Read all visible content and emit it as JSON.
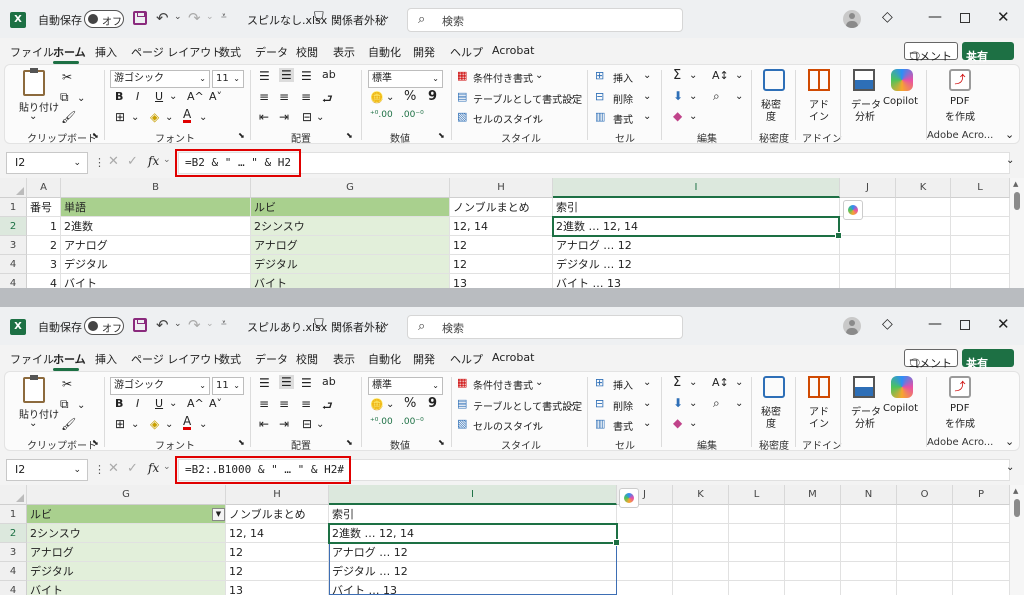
{
  "title": {
    "autosave": "自動保存",
    "toggle": "オフ",
    "sensitivity": "関係者外秘",
    "search_placeholder": "検索"
  },
  "menu": {
    "tabs": [
      "ファイル",
      "ホーム",
      "挿入",
      "ページ レイアウト",
      "数式",
      "データ",
      "校閲",
      "表示",
      "自動化",
      "開発",
      "ヘルプ",
      "Acrobat"
    ],
    "comment": "コメント",
    "share": "共有"
  },
  "ribbon": {
    "paste": "貼り付け",
    "clipboard": "クリップボード",
    "font_name": "游ゴシック",
    "font_size": "11",
    "bold": "B",
    "italic": "I",
    "underline": "U",
    "grow": "A^",
    "shrink": "A˅",
    "font": "フォント",
    "alignment": "配置",
    "number_format": "標準",
    "percent": "%",
    "comma": "9",
    "number": "数値",
    "conditional": "条件付き書式",
    "as_table": "テーブルとして書式設定",
    "cell_style": "セルのスタイル",
    "styles": "スタイル",
    "insert": "挿入",
    "delete": "削除",
    "format": "書式",
    "cells": "セル",
    "editing": "編集",
    "sensitivity_btn": "秘密度",
    "sensitivity_line1": "秘密",
    "sensitivity_line2": "度",
    "addin_line1": "アド",
    "addin_line2": "イン",
    "addin": "アドイン",
    "analyze_line1": "データ",
    "analyze_line2": "分析",
    "copilot": "Copilot",
    "pdf_line1": "PDF",
    "pdf_line2": "を作成",
    "adobe": "Adobe Acro..."
  },
  "top": {
    "filename": "スピルなし.xlsx",
    "namebox": "I2",
    "formula": "=B2 & \" … \" & H2",
    "columns": [
      "A",
      "B",
      "G",
      "H",
      "I",
      "J",
      "K",
      "L"
    ],
    "rows": [
      "1",
      "2",
      "3",
      "4"
    ],
    "cells": {
      "A1": "番号",
      "B1": "単語",
      "G1": "ルビ",
      "H1": "ノンブルまとめ",
      "I1": "索引",
      "A2": "1",
      "B2": "2進数",
      "G2": "2シンスウ",
      "H2": "12, 14",
      "I2": "2進数 … 12, 14",
      "A3": "2",
      "B3": "アナログ",
      "G3": "アナログ",
      "H3": "12",
      "I3": "アナログ … 12",
      "A4": "3",
      "B4": "デジタル",
      "G4": "デジタル",
      "H4": "12",
      "I4": "デジタル … 12",
      "A5": "4",
      "B5": "バイト",
      "G5": "バイト",
      "H5": "13",
      "I5": "バイト … 13"
    }
  },
  "bottom": {
    "filename": "スピルあり.xlsx",
    "namebox": "I2",
    "formula": "=B2:.B1000 & \" … \" & H2#",
    "columns": [
      "G",
      "H",
      "I",
      "J",
      "K",
      "L",
      "M",
      "N",
      "O",
      "P"
    ],
    "rows": [
      "1",
      "2",
      "3",
      "4"
    ],
    "cells": {
      "G1": "ルビ",
      "H1": "ノンブルまとめ",
      "I1": "索引",
      "G2": "2シンスウ",
      "H2": "12, 14",
      "I2": "2進数 … 12, 14",
      "G3": "アナログ",
      "H3": "12",
      "I3": "アナログ … 12",
      "G4": "デジタル",
      "H4": "12",
      "I4": "デジタル … 12",
      "G5": "バイト",
      "H5": "13",
      "I5": "バイト … 13"
    }
  },
  "colors": {
    "header_green": "#a9d08e",
    "light_green": "#e2efda",
    "excel_green": "#1d7044",
    "highlight_red": "#e00000"
  }
}
